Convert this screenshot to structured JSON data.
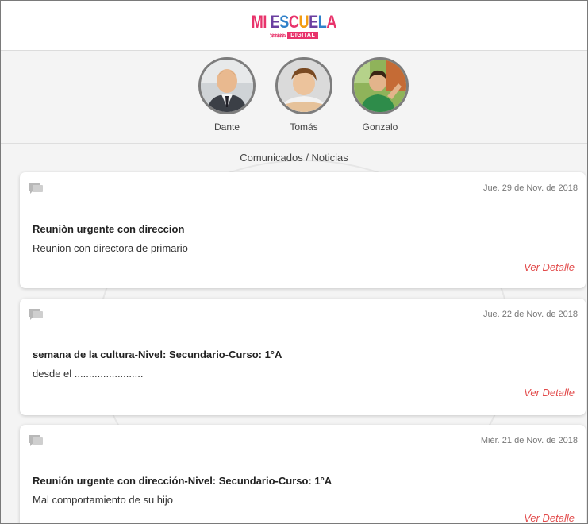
{
  "header": {
    "logo": {
      "text": "MI ESCUELA",
      "tag": "DIGITAL",
      "chevrons": ">>>>>>"
    }
  },
  "children": [
    {
      "name": "Dante"
    },
    {
      "name": "Tomás"
    },
    {
      "name": "Gonzalo"
    }
  ],
  "section": {
    "title": "Comunicados / Noticias"
  },
  "cards": [
    {
      "date": "Jue. 29 de Nov. de 2018",
      "title": "Reuniòn urgente con direccion",
      "body": "Reunion con directora de primario",
      "link": "Ver Detalle"
    },
    {
      "date": "Jue. 22 de Nov. de 2018",
      "title": "semana de la cultura-Nivel: Secundario-Curso: 1°A",
      "body": "desde el ........................",
      "link": "Ver Detalle"
    },
    {
      "date": "Miér. 21 de Nov. de 2018",
      "title": "Reunión urgente con dirección-Nivel: Secundario-Curso: 1°A",
      "body": "Mal comportamiento de su hijo",
      "link": "Ver Detalle"
    }
  ],
  "icons": {
    "message": "chat-bubble-icon"
  },
  "colors": {
    "link": "#e24a4a",
    "logo_pink": "#e8336b",
    "logo_orange": "#f39c12",
    "logo_purple": "#6b3fa0",
    "logo_blue": "#2f80c9"
  }
}
